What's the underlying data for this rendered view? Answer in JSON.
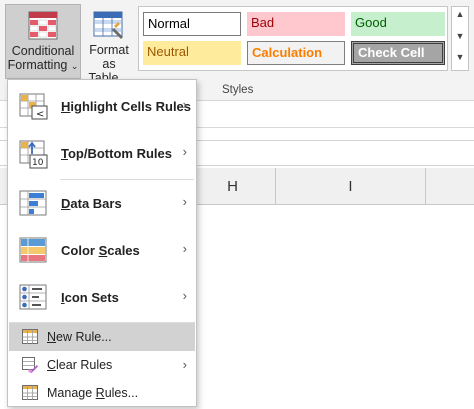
{
  "ribbon": {
    "conditional_formatting": {
      "line1": "Conditional",
      "line2": "Formatting",
      "chevron": "⌄"
    },
    "format_as_table": {
      "line1": "Format as",
      "line2": "Table",
      "chevron": "⌄"
    },
    "cell_styles": {
      "normal": "Normal",
      "bad": "Bad",
      "good": "Good",
      "neutral": "Neutral",
      "calculation": "Calculation",
      "check_cell": "Check Cell"
    },
    "gallery_scroll": {
      "up": "▲",
      "down": "▼",
      "more": "▼"
    },
    "group_label": "Styles"
  },
  "sheet": {
    "columns": [
      "H",
      "I"
    ]
  },
  "menu": {
    "items": [
      {
        "before": "",
        "key": "H",
        "after": "ighlight Cells Rules",
        "icon": "highlight-cells-icon",
        "submenu": true
      },
      {
        "before": "",
        "key": "T",
        "after": "op/Bottom Rules",
        "icon": "top-bottom-icon",
        "submenu": true
      },
      {
        "before": "",
        "key": "D",
        "after": "ata Bars",
        "icon": "data-bars-icon",
        "submenu": true
      },
      {
        "before": "Color ",
        "key": "S",
        "after": "cales",
        "icon": "color-scales-icon",
        "submenu": true
      },
      {
        "before": "",
        "key": "I",
        "after": "con Sets",
        "icon": "icon-sets-icon",
        "submenu": true
      },
      {
        "before": "",
        "key": "N",
        "after": "ew Rule...",
        "icon": "new-rule-icon",
        "submenu": false,
        "highlighted": true
      },
      {
        "before": "",
        "key": "C",
        "after": "lear Rules",
        "icon": "clear-rules-icon",
        "submenu": true
      },
      {
        "before": "Manage ",
        "key": "R",
        "after": "ules...",
        "icon": "manage-rules-icon",
        "submenu": false
      }
    ],
    "arrow": "›"
  },
  "colors": {
    "ribbon_bg": "#f3f3f3",
    "pressed_button": "#cfcfcf",
    "menu_highlight": "#d2d2d2",
    "bad_fill": "#ffc7ce",
    "good_fill": "#c6efce",
    "neutral_fill": "#ffeb9c",
    "calc_text": "#fa7d00",
    "check_fill": "#a5a5a5"
  }
}
